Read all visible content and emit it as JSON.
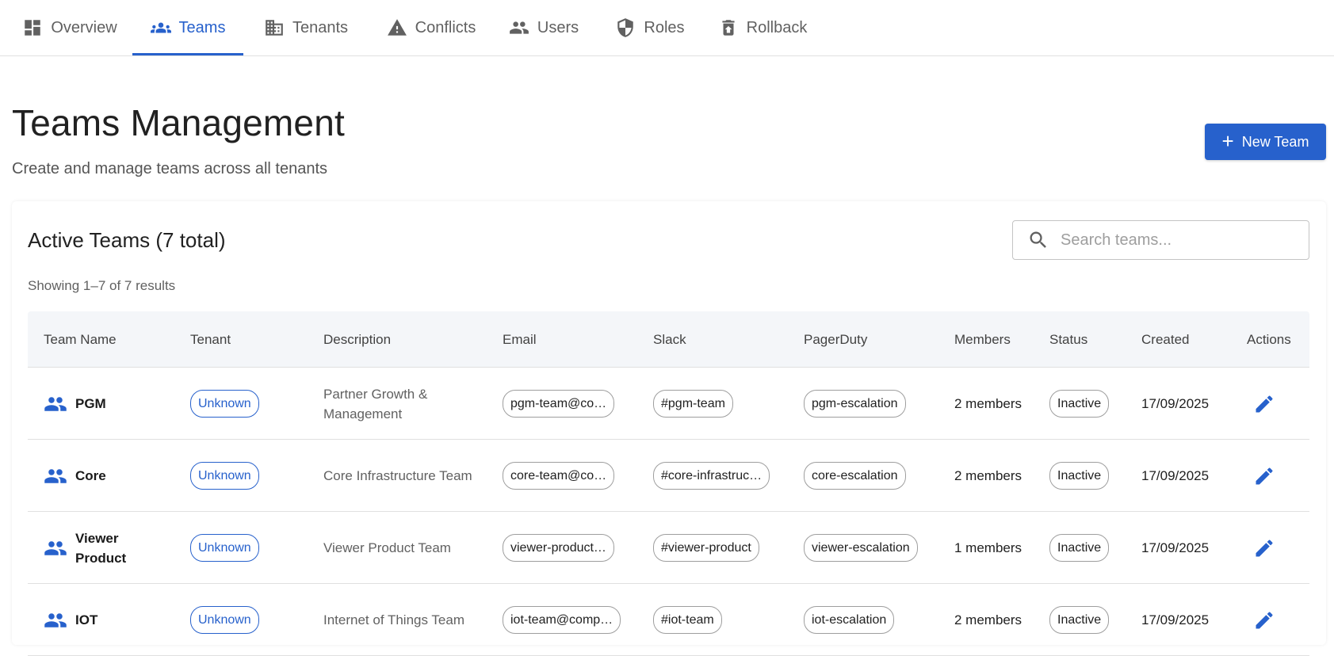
{
  "nav": {
    "tabs": [
      {
        "label": "Overview",
        "icon": "dashboard-icon",
        "active": false
      },
      {
        "label": "Teams",
        "icon": "groups-icon",
        "active": true
      },
      {
        "label": "Tenants",
        "icon": "building-icon",
        "active": false
      },
      {
        "label": "Conflicts",
        "icon": "warning-icon",
        "active": false
      },
      {
        "label": "Users",
        "icon": "people-icon",
        "active": false
      },
      {
        "label": "Roles",
        "icon": "shield-icon",
        "active": false
      },
      {
        "label": "Rollback",
        "icon": "restore-bin-icon",
        "active": false
      }
    ]
  },
  "header": {
    "title": "Teams Management",
    "subtitle": "Create and manage teams across all tenants",
    "new_button_label": "New Team"
  },
  "card": {
    "title": "Active Teams (7 total)",
    "results_text": "Showing 1–7 of 7 results",
    "search_placeholder": "Search teams..."
  },
  "table": {
    "columns": [
      "Team Name",
      "Tenant",
      "Description",
      "Email",
      "Slack",
      "PagerDuty",
      "Members",
      "Status",
      "Created",
      "Actions"
    ],
    "rows": [
      {
        "name": "PGM",
        "tenant": "Unknown",
        "description": "Partner Growth & Management",
        "email": "pgm-team@co…",
        "slack": "#pgm-team",
        "pagerduty": "pgm-escalation",
        "members": "2 members",
        "status": "Inactive",
        "created": "17/09/2025"
      },
      {
        "name": "Core",
        "tenant": "Unknown",
        "description": "Core Infrastructure Team",
        "email": "core-team@co…",
        "slack": "#core-infrastruc…",
        "pagerduty": "core-escalation",
        "members": "2 members",
        "status": "Inactive",
        "created": "17/09/2025"
      },
      {
        "name": "Viewer Product",
        "tenant": "Unknown",
        "description": "Viewer Product Team",
        "email": "viewer-product…",
        "slack": "#viewer-product",
        "pagerduty": "viewer-escalation",
        "members": "1 members",
        "status": "Inactive",
        "created": "17/09/2025"
      },
      {
        "name": "IOT",
        "tenant": "Unknown",
        "description": "Internet of Things Team",
        "email": "iot-team@comp…",
        "slack": "#iot-team",
        "pagerduty": "iot-escalation",
        "members": "2 members",
        "status": "Inactive",
        "created": "17/09/2025"
      }
    ]
  },
  "colors": {
    "accent": "#2761cc",
    "header_bg": "#f4f6f9",
    "border": "#e0e0e0"
  }
}
